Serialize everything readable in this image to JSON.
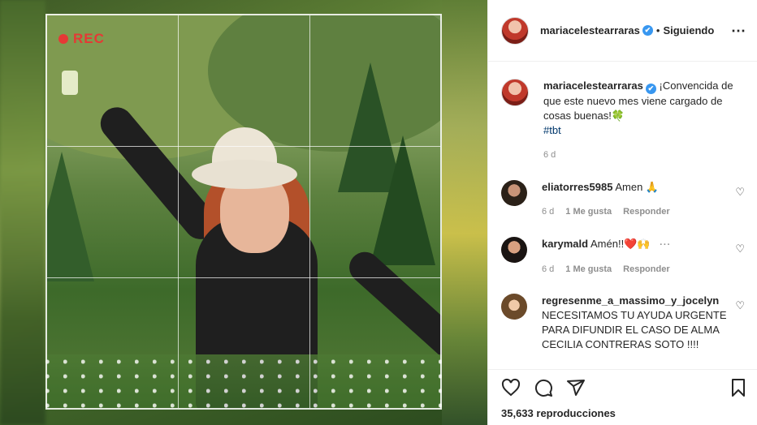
{
  "header": {
    "username": "mariacelestearraras",
    "verified_badge": "✔",
    "follow_status": "Siguiendo",
    "more_icon": "⋯"
  },
  "media": {
    "rec_label": "REC",
    "colors": {
      "rec": "#e53935",
      "grid": "#ffffff"
    }
  },
  "caption": {
    "username": "mariacelestearraras",
    "text": "¡Convencida de que este nuevo mes viene cargado de cosas buenas!🍀",
    "hashtag": "#tbt",
    "time": "6 d"
  },
  "comments": [
    {
      "username": "eliatorres5985",
      "text": "Amen 🙏",
      "time": "6 d",
      "likes": "1 Me gusta",
      "reply": "Responder"
    },
    {
      "username": "karymald",
      "text": "Amén!!❤️🙌",
      "time": "6 d",
      "likes": "1 Me gusta",
      "reply": "Responder"
    },
    {
      "username": "regresenme_a_massimo_y_jocelyn",
      "text": "NECESITAMOS TU AYUDA URGENTE PARA DIFUNDIR EL CASO DE ALMA CECILIA CONTRERAS SOTO !!!!"
    }
  ],
  "actions": {
    "views_count": "35,633",
    "views_label": "reproducciones"
  },
  "colors": {
    "verified": "#3897f0",
    "link": "#00376b",
    "muted": "#8e8e8e"
  }
}
